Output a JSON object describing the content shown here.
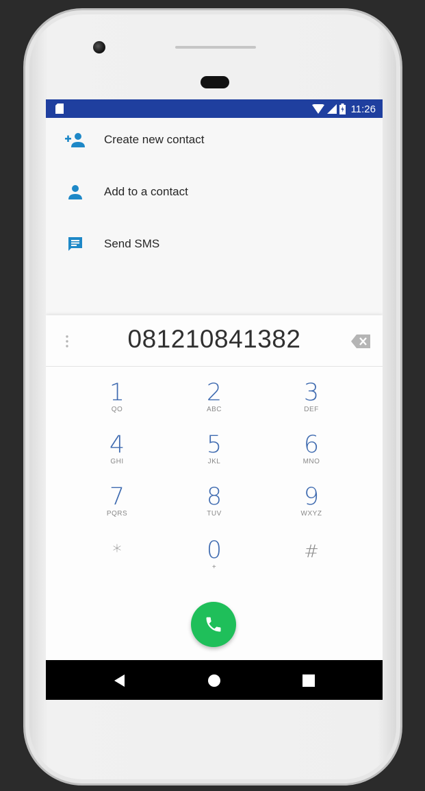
{
  "statusbar": {
    "time": "11:26",
    "icons": [
      "sim-card-icon",
      "wifi-icon",
      "signal-icon",
      "battery-icon"
    ]
  },
  "actions": [
    {
      "label": "Create new contact",
      "icon": "person-add-icon"
    },
    {
      "label": "Add to a contact",
      "icon": "person-icon"
    },
    {
      "label": "Send SMS",
      "icon": "message-icon"
    }
  ],
  "dialer": {
    "number": "081210841382",
    "keys": [
      {
        "digit": "1",
        "letters": "QO"
      },
      {
        "digit": "2",
        "letters": "ABC"
      },
      {
        "digit": "3",
        "letters": "DEF"
      },
      {
        "digit": "4",
        "letters": "GHI"
      },
      {
        "digit": "5",
        "letters": "JKL"
      },
      {
        "digit": "6",
        "letters": "MNO"
      },
      {
        "digit": "7",
        "letters": "PQRS"
      },
      {
        "digit": "8",
        "letters": "TUV"
      },
      {
        "digit": "9",
        "letters": "WXYZ"
      },
      {
        "digit": "*",
        "letters": ""
      },
      {
        "digit": "0",
        "letters": "+"
      },
      {
        "digit": "#",
        "letters": ""
      }
    ]
  },
  "colors": {
    "statusbar": "#1f3f9f",
    "accent": "#1e88c7",
    "digit": "#3f6bb0",
    "call": "#1fbf5a"
  },
  "navbar": {
    "buttons": [
      "back-icon",
      "home-icon",
      "recents-icon"
    ]
  }
}
